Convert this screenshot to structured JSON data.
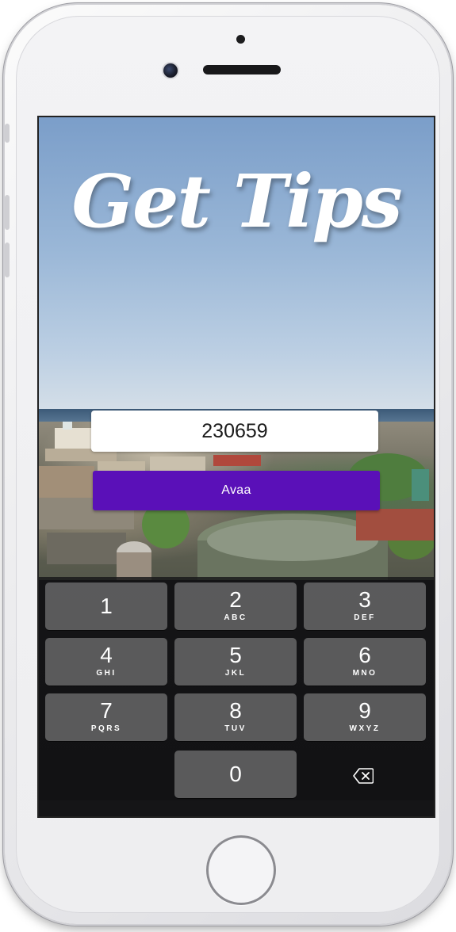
{
  "app": {
    "title": "Get Tips"
  },
  "form": {
    "code_value": "230659",
    "open_button_label": "Avaa"
  },
  "keypad": {
    "keys": [
      {
        "digit": "1",
        "letters": ""
      },
      {
        "digit": "2",
        "letters": "ABC"
      },
      {
        "digit": "3",
        "letters": "DEF"
      },
      {
        "digit": "4",
        "letters": "GHI"
      },
      {
        "digit": "5",
        "letters": "JKL"
      },
      {
        "digit": "6",
        "letters": "MNO"
      },
      {
        "digit": "7",
        "letters": "PQRS"
      },
      {
        "digit": "8",
        "letters": "TUV"
      },
      {
        "digit": "9",
        "letters": "WXYZ"
      },
      {
        "digit": "0",
        "letters": ""
      }
    ],
    "delete_icon": "backspace-icon"
  },
  "colors": {
    "accent": "#5a10b8",
    "key_background": "#6e6e70",
    "keypad_background": "#161618"
  }
}
